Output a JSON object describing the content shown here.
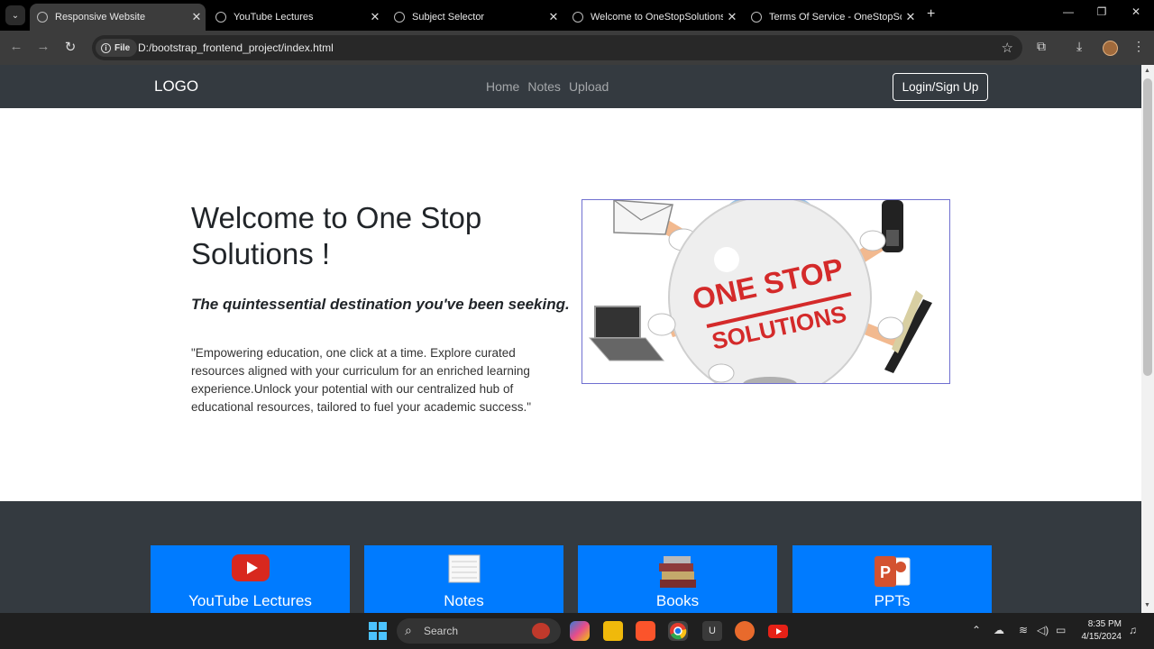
{
  "browser": {
    "tabs": [
      {
        "title": "Responsive Website",
        "active": true
      },
      {
        "title": "YouTube Lectures",
        "active": false
      },
      {
        "title": "Subject Selector",
        "active": false
      },
      {
        "title": "Welcome to OneStopSolutions",
        "active": false
      },
      {
        "title": "Terms Of Service - OneStopSolutions",
        "active": false
      }
    ],
    "security_chip": "File",
    "url": "D:/bootstrap_frontend_project/index.html"
  },
  "site": {
    "nav": {
      "logo": "LOGO",
      "links": [
        "Home",
        "Notes",
        "Upload"
      ],
      "login_label": "Login/Sign Up"
    },
    "hero": {
      "title": "Welcome to One Stop Solutions !",
      "tagline": "The quintessential destination you've been seeking.",
      "blurb": "\"Empowering education, one click at a time. Explore curated resources aligned with your curriculum for an enriched learning experience.Unlock your potential with our centralized hub of educational resources, tailored to fuel your academic success.\"",
      "image_text": [
        "ONE STOP",
        "SOLUTIONS"
      ]
    },
    "cards": [
      {
        "label": "YouTube Lectures",
        "icon": "youtube-icon"
      },
      {
        "label": "Notes",
        "icon": "notepad-icon"
      },
      {
        "label": "Books",
        "icon": "books-icon"
      },
      {
        "label": "PPTs",
        "icon": "powerpoint-icon"
      }
    ],
    "colors": {
      "navbar": "#343a40",
      "card": "#007bff"
    }
  },
  "taskbar": {
    "search_label": "Search",
    "time": "8:35 PM",
    "date": "4/15/2024"
  }
}
